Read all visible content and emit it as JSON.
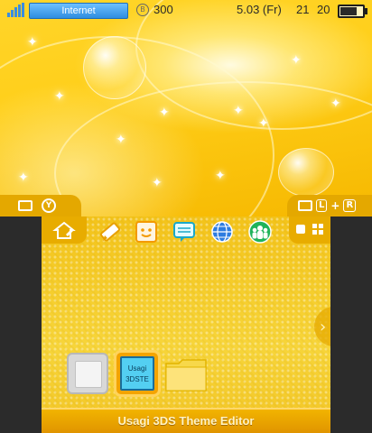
{
  "status": {
    "connection_label": "Internet",
    "coin_symbol": "B",
    "coin_count": "300",
    "date": "5.03 (Fr)",
    "hour": "21",
    "minute": "20",
    "battery_level": 0.7
  },
  "top_badges": {
    "left": {
      "camera_icon": "camera-box-icon",
      "y_button": "Y"
    },
    "right": {
      "camera_icon": "camera-icon",
      "l_key": "L",
      "plus": "+",
      "r_key": "R"
    }
  },
  "bottom": {
    "app_icons": [
      "pencil-icon",
      "smiley-icon",
      "chat-icon",
      "globe-icon",
      "friends-icon"
    ],
    "selected_app_label_line1": "Usagi",
    "selected_app_label_line2": "3DSTE",
    "footer_title": "Usagi 3DS Theme Editor"
  },
  "colors": {
    "accent": "#e8ac00",
    "internet_blue": "#2e8de0"
  }
}
